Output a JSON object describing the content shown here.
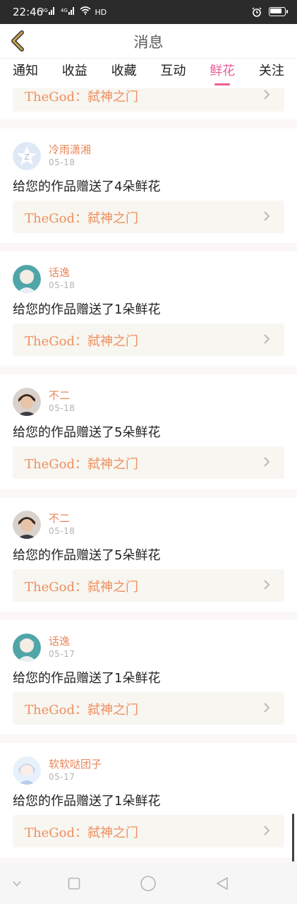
{
  "status_bar": {
    "time": "22:46",
    "signal1": "4G",
    "signal2": "4G",
    "network": "HD",
    "battery_level": 0.9
  },
  "header": {
    "title": "消息"
  },
  "tabs": [
    {
      "label": "通知",
      "active": false
    },
    {
      "label": "收益",
      "active": false
    },
    {
      "label": "收藏",
      "active": false
    },
    {
      "label": "互动",
      "active": false
    },
    {
      "label": "鲜花",
      "active": true
    },
    {
      "label": "关注",
      "active": false
    }
  ],
  "partial_card": {
    "work_title": "TheGod：弑神之门"
  },
  "notifications": [
    {
      "username": "冷雨潇湘",
      "date": "05-18",
      "message": "给您的作品赠送了4朵鲜花",
      "work_title": "TheGod：弑神之门",
      "avatar": "default-avatar-icon"
    },
    {
      "username": "话逸",
      "date": "05-18",
      "message": "给您的作品赠送了1朵鲜花",
      "work_title": "TheGod：弑神之门",
      "avatar": "anime-avatar-icon"
    },
    {
      "username": "不二",
      "date": "05-18",
      "message": "给您的作品赠送了5朵鲜花",
      "work_title": "TheGod：弑神之门",
      "avatar": "photo-avatar-icon"
    },
    {
      "username": "不二",
      "date": "05-18",
      "message": "给您的作品赠送了5朵鲜花",
      "work_title": "TheGod：弑神之门",
      "avatar": "photo-avatar-icon"
    },
    {
      "username": "话逸",
      "date": "05-17",
      "message": "给您的作品赠送了1朵鲜花",
      "work_title": "TheGod：弑神之门",
      "avatar": "anime-avatar-icon"
    },
    {
      "username": "软软哒团子",
      "date": "05-17",
      "message": "给您的作品赠送了1朵鲜花",
      "work_title": "TheGod：弑神之门",
      "avatar": "anime-girl-avatar-icon"
    }
  ],
  "colors": {
    "accent_pink": "#ea5f97",
    "username": "#e8875a",
    "work_title": "#ef8f5e",
    "back_icon": "#c6a34a"
  }
}
